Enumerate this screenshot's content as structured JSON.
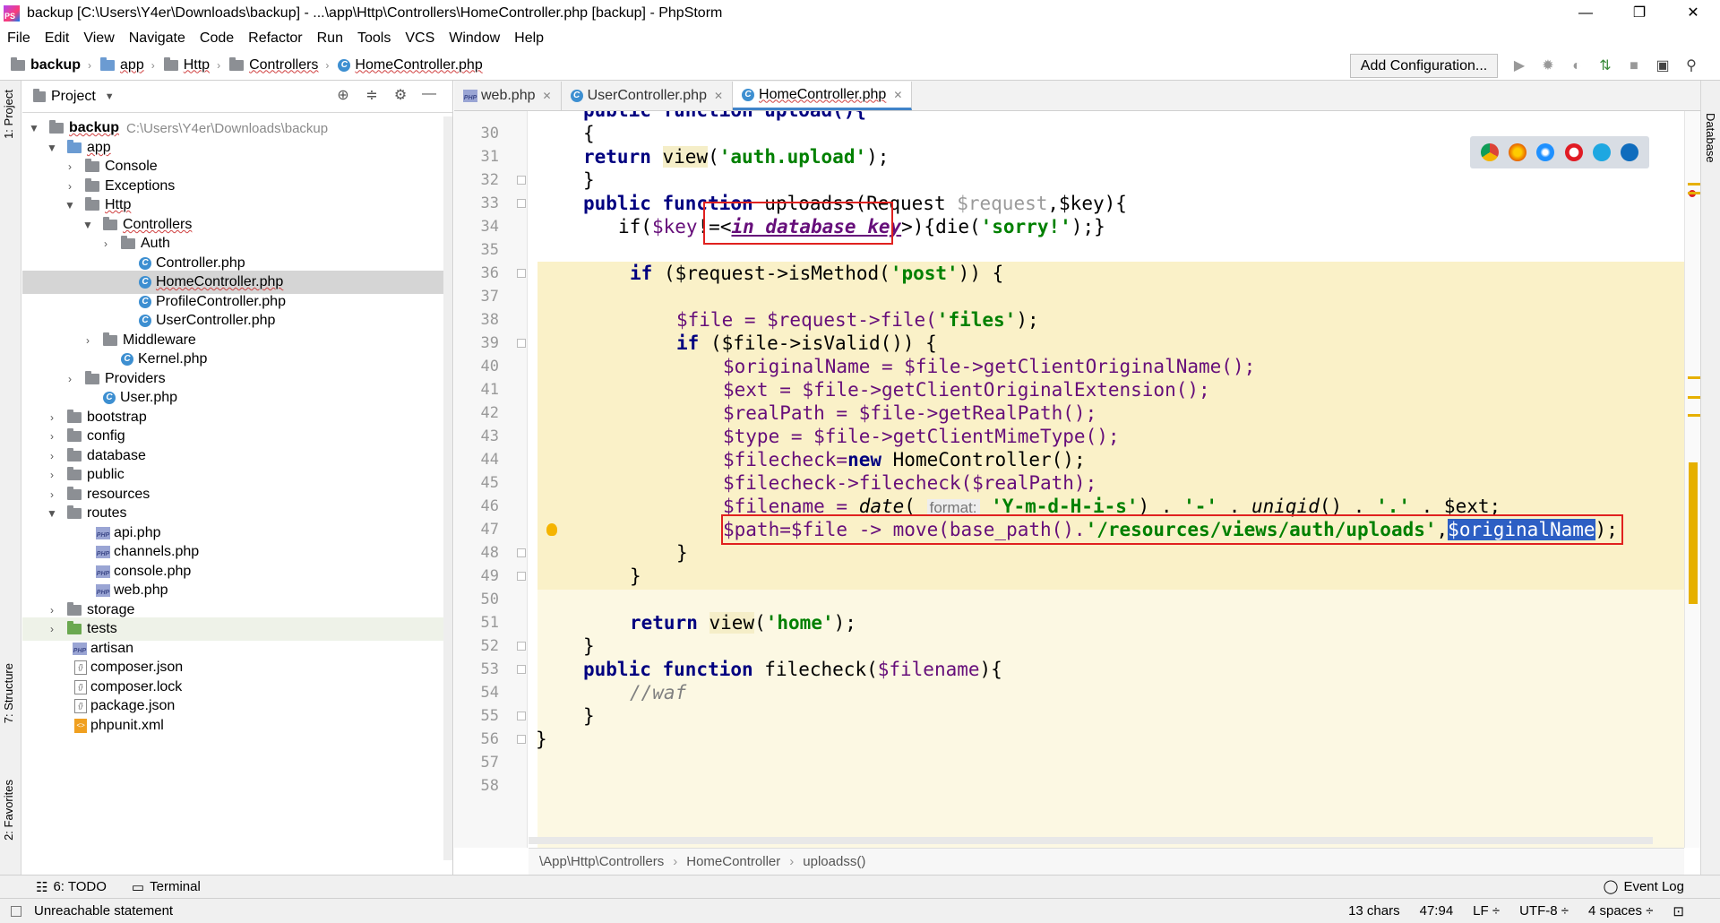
{
  "window": {
    "title": "backup [C:\\Users\\Y4er\\Downloads\\backup] - ...\\app\\Http\\Controllers\\HomeController.php [backup] - PhpStorm",
    "minimize": "—",
    "restore": "❐",
    "close": "✕"
  },
  "menu": [
    "File",
    "Edit",
    "View",
    "Navigate",
    "Code",
    "Refactor",
    "Run",
    "Tools",
    "VCS",
    "Window",
    "Help"
  ],
  "breadcrumb": [
    "backup",
    "app",
    "Http",
    "Controllers",
    "HomeController.php"
  ],
  "toolbar": {
    "add_configuration": "Add Configuration..."
  },
  "left_tabs": {
    "project": "1: Project",
    "structure": "7: Structure",
    "favorites": "2: Favorites"
  },
  "right_tabs": {
    "database": "Database"
  },
  "project": {
    "title": "Project",
    "root_name": "backup",
    "root_path": "C:\\Users\\Y4er\\Downloads\\backup",
    "items": [
      "app",
      "Console",
      "Exceptions",
      "Http",
      "Controllers",
      "Auth",
      "Controller.php",
      "HomeController.php",
      "ProfileController.php",
      "UserController.php",
      "Middleware",
      "Kernel.php",
      "Providers",
      "User.php",
      "bootstrap",
      "config",
      "database",
      "public",
      "resources",
      "routes",
      "api.php",
      "channels.php",
      "console.php",
      "web.php",
      "storage",
      "tests",
      "artisan",
      "composer.json",
      "composer.lock",
      "package.json",
      "phpunit.xml"
    ]
  },
  "tabs": [
    "web.php",
    "UserController.php",
    "HomeController.php"
  ],
  "line_numbers": [
    "30",
    "31",
    "32",
    "33",
    "34",
    "35",
    "36",
    "37",
    "38",
    "39",
    "40",
    "41",
    "42",
    "43",
    "44",
    "45",
    "46",
    "47",
    "48",
    "49",
    "50",
    "51",
    "52",
    "53",
    "54",
    "55",
    "56",
    "57",
    "58"
  ],
  "code": {
    "l29": "public function upload(){",
    "l30": "{",
    "l31_kw": "return",
    "l31_fn": "view",
    "l31_str": "'auth.upload'",
    "l31_end": ");",
    "l32": "}",
    "l33_a": "public function",
    "l33_b": " uploadss(Request ",
    "l33_var": "$request",
    "l33_c": ",$key){",
    "l34_a": "if(",
    "l34_var": "$key",
    "l34_b": "!=",
    "l34_c": "<",
    "l34_ph": "in database key",
    "l34_d": ">)",
    "l34_e": "{die(",
    "l34_str": "'sorry!'",
    "l34_f": ");}",
    "l36_a": "if",
    "l36_b": " ($request->isMethod(",
    "l36_str": "'post'",
    "l36_c": ")) {",
    "l38_a": "$file = $request->file(",
    "l38_str": "'files'",
    "l38_b": ");",
    "l39_a": "if",
    "l39_b": " ($file->isValid()) {",
    "l40": "$originalName = $file->getClientOriginalName();",
    "l41": "$ext = $file->getClientOriginalExtension();",
    "l42": "$realPath = $file->getRealPath();",
    "l43": "$type = $file->getClientMimeType();",
    "l44_a": "$filecheck=",
    "l44_kw": "new",
    "l44_b": " HomeController();",
    "l45": "$filecheck->filecheck($realPath);",
    "l46_a": "$filename = ",
    "l46_fn": "date",
    "l46_b": "( ",
    "l46_hint": "format:",
    "l46_str": "'Y-m-d-H-i-s'",
    "l46_c": ") . ",
    "l46_str2": "'-'",
    "l46_d": " . ",
    "l46_fn2": "uniqid",
    "l46_e": "() . ",
    "l46_str3": "'.'",
    "l46_f": " . $ext;",
    "l47_a": "$path=$file -> move(base_path().",
    "l47_str": "'/resources/views/auth/uploads'",
    "l47_b": ",",
    "l47_sel": "$originalName",
    "l47_c": ");",
    "l48": "}",
    "l49": "}",
    "l51_kw": "return",
    "l51_fn": "view",
    "l51_str": "'home'",
    "l51_end": ");",
    "l52": "}",
    "l53_a": "public function",
    "l53_b": " filecheck(",
    "l53_var": "$filename",
    "l53_c": "){",
    "l54": "//waf",
    "l55": "}",
    "l56": "}"
  },
  "editor_breadcrumb": [
    "\\App\\Http\\Controllers",
    "HomeController",
    "uploadss()"
  ],
  "bottom_tools": {
    "todo": "6: TODO",
    "terminal": "Terminal",
    "event_log": "Event Log"
  },
  "status": {
    "message": "Unreachable statement",
    "chars": "13 chars",
    "position": "47:94",
    "line_sep": "LF ÷",
    "encoding": "UTF-8 ÷",
    "indent": "4 spaces ÷"
  },
  "colors": {
    "accent": "#4083c9",
    "highlight": "#faf1c8",
    "selection": "#2d5fc4",
    "annotation": "#e0211f"
  }
}
